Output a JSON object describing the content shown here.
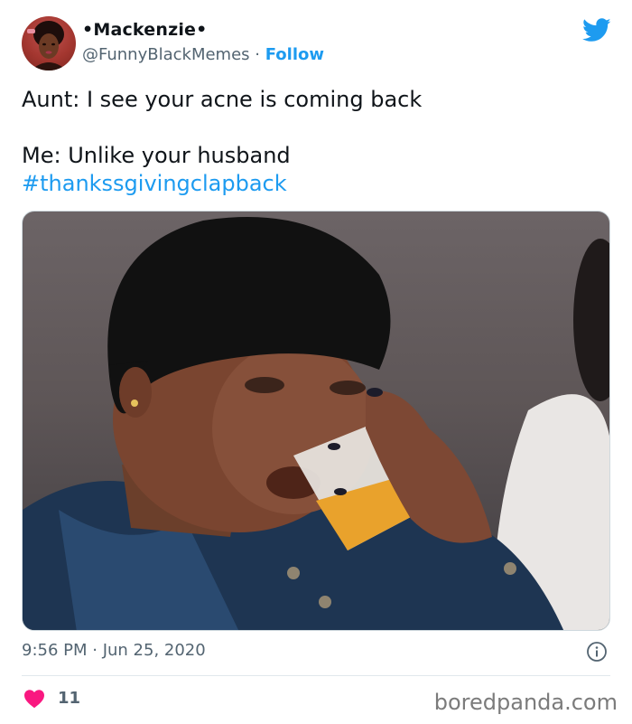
{
  "author": {
    "name": "•Mackenzie•",
    "handle": "@FunnyBlackMemes",
    "separator": " · ",
    "follow_label": "Follow"
  },
  "icons": {
    "brand": "twitter-bird-icon",
    "info": "info-icon",
    "like": "heart-icon"
  },
  "colors": {
    "accent": "#1d9bf0",
    "heart": "#f91880",
    "muted": "#536471"
  },
  "tweet": {
    "line1": "Aunt: I see your acne is coming back",
    "line2": "Me: Unlike your husband",
    "hashtag": "#thankssgivingclapback"
  },
  "meta": {
    "timestamp": "9:56 PM · Jun 25, 2020",
    "likes": "11"
  },
  "watermark": "boredpanda.com"
}
